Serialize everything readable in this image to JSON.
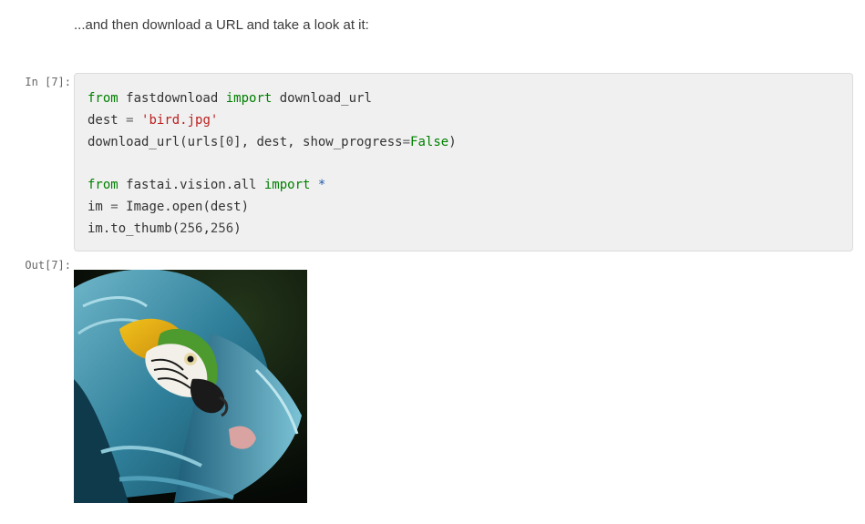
{
  "markdown": {
    "text": "...and then download a URL and take a look at it:"
  },
  "cell": {
    "in_prompt": "In [7]:",
    "out_prompt": "Out[7]:",
    "code": {
      "l1": {
        "kw1": "from",
        "mod": " fastdownload ",
        "kw2": "import",
        "name": " download_url"
      },
      "l2": {
        "lhs": "dest ",
        "op": "=",
        "sp": " ",
        "str": "'bird.jpg'"
      },
      "l3": {
        "a": "download_url(urls[",
        "idx": "0",
        "b": "], dest, show_progress",
        "op": "=",
        "val": "False",
        "c": ")"
      },
      "l5": {
        "kw1": "from",
        "mod": " fastai.vision.all ",
        "kw2": "import",
        "sp": " ",
        "star": "*"
      },
      "l6": {
        "lhs": "im ",
        "op": "=",
        "rhs": " Image.open(dest)"
      },
      "l7": {
        "a": "im.to_thumb(",
        "n1": "256",
        "comma": ",",
        "n2": "256",
        "b": ")"
      }
    }
  },
  "output": {
    "image_subject": "macaw-parrot-photo"
  }
}
